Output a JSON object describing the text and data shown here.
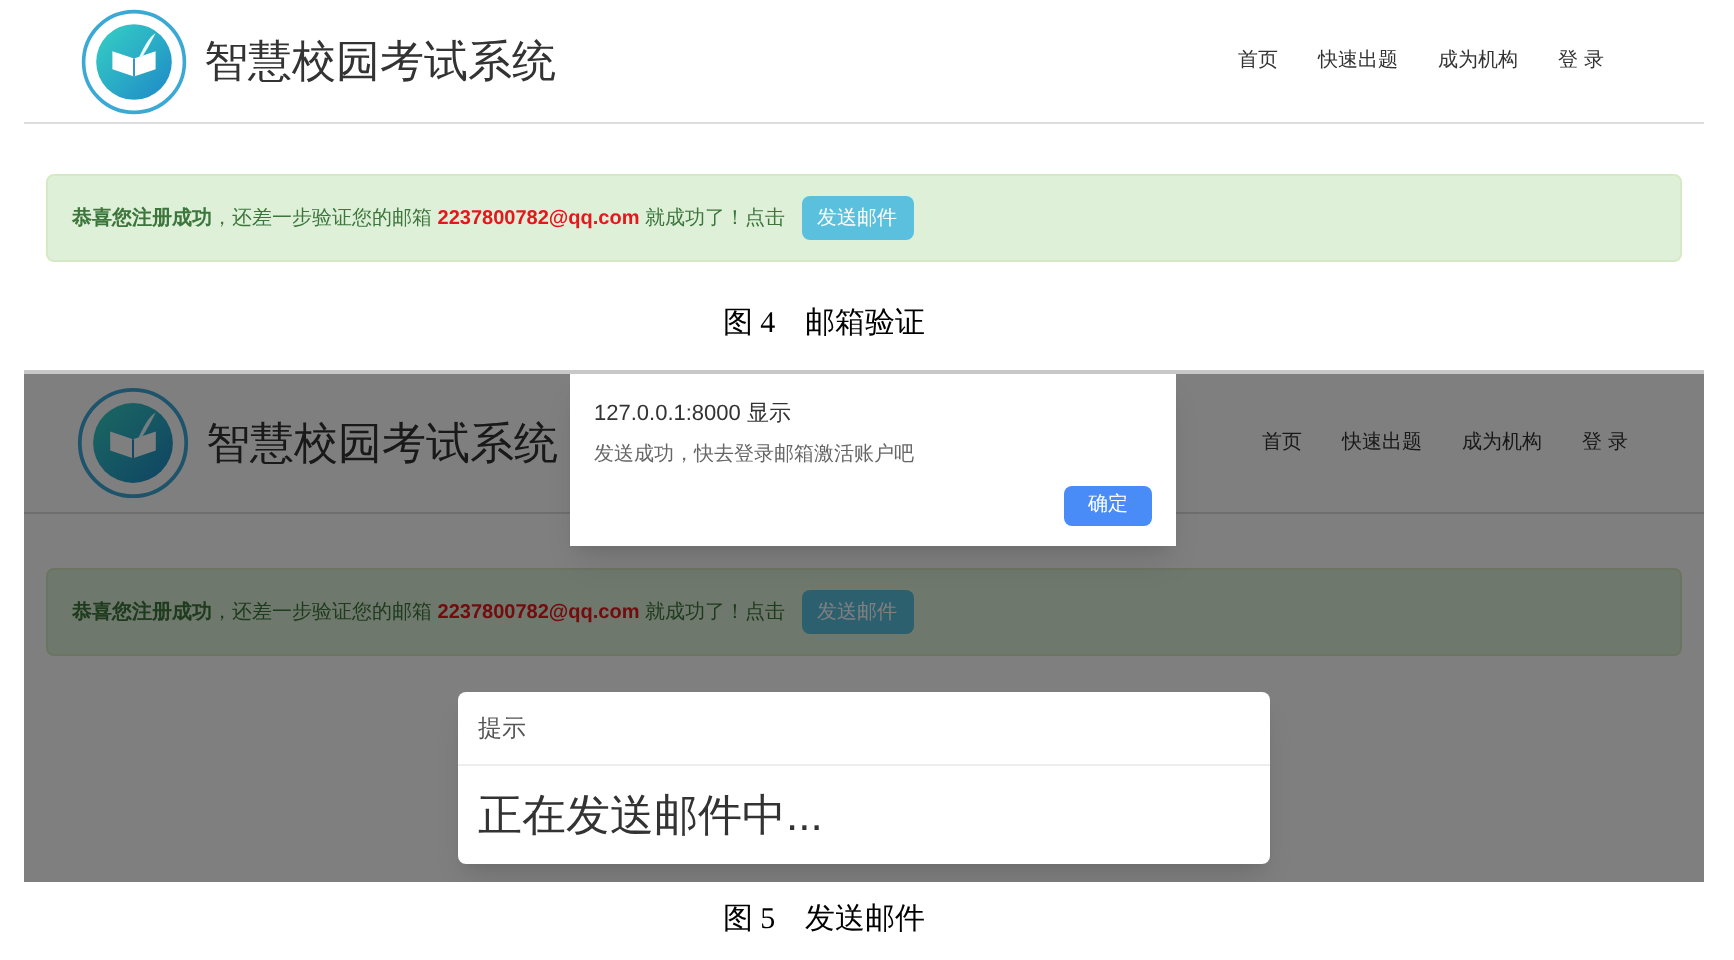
{
  "figures": [
    {
      "header": {
        "title": "智慧校园考试系统",
        "nav": [
          "首页",
          "快速出题",
          "成为机构",
          "登 录"
        ]
      },
      "alert": {
        "lead": "恭喜您注册成功",
        "text": "，还差一步验证您的邮箱",
        "email": "2237800782@qq.com",
        "text2": "就成功了！点击",
        "button": "发送邮件"
      },
      "dimmed": false,
      "caption": "图 4　邮箱验证"
    },
    {
      "header": {
        "title": "智慧校园考试系统",
        "nav": [
          "首页",
          "快速出题",
          "成为机构",
          "登 录"
        ]
      },
      "alert": {
        "lead": "恭喜您注册成功",
        "text": "，还差一步验证您的邮箱",
        "email": "2237800782@qq.com",
        "text2": "就成功了！点击",
        "button": "发送邮件"
      },
      "dimmed": true,
      "browser_dialog": {
        "title": "127.0.0.1:8000 显示",
        "message": "发送成功，快去登录邮箱激活账户吧",
        "button": "确定"
      },
      "modal": {
        "title": "提示",
        "body": "正在发送邮件中..."
      },
      "caption": "图 5　发送邮件"
    }
  ]
}
